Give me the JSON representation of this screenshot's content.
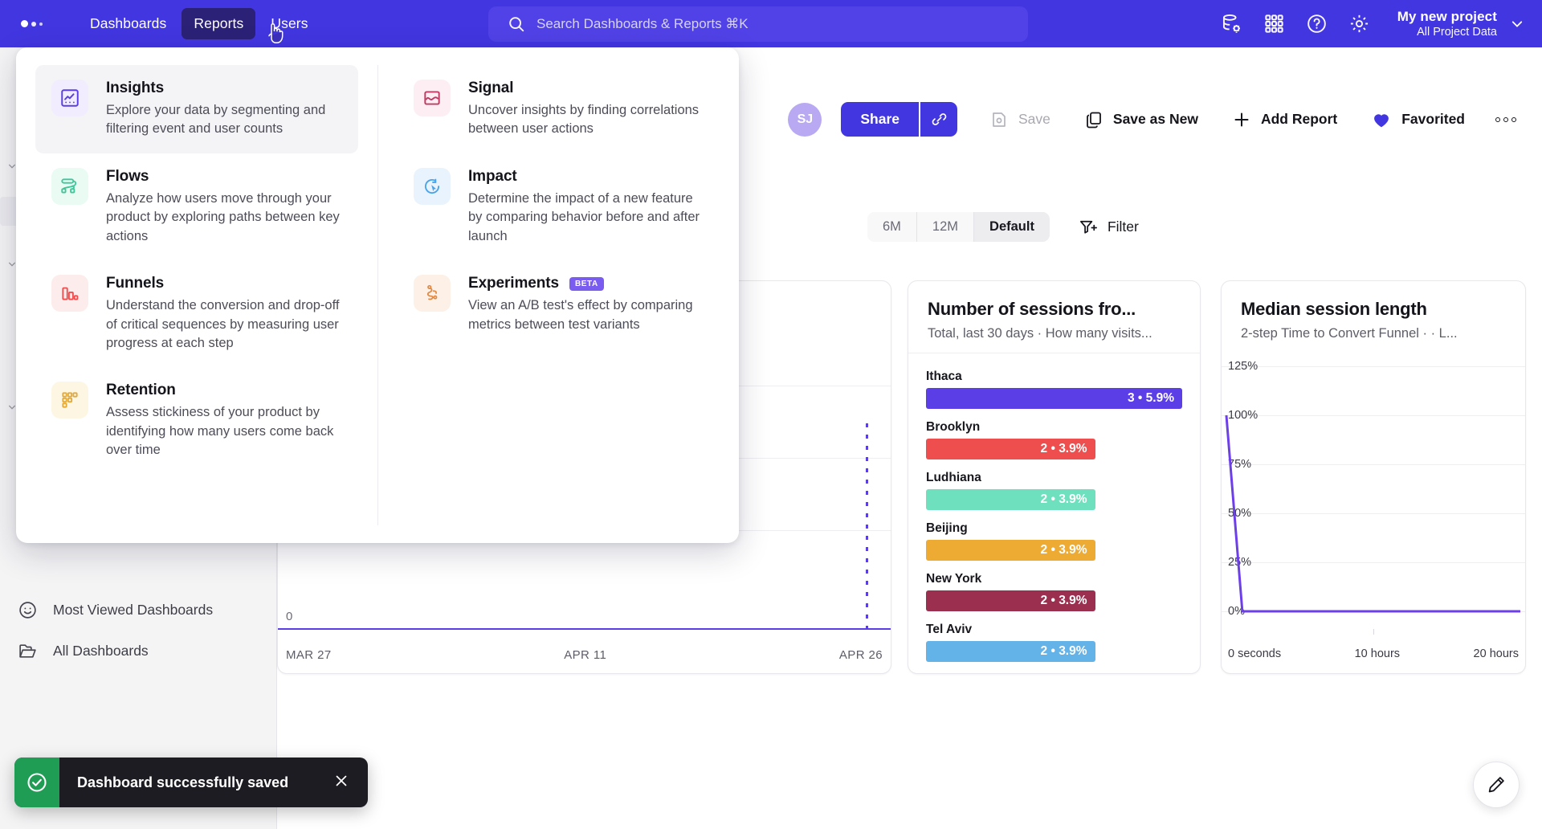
{
  "topnav": {
    "logo": "logo-dots",
    "links": [
      {
        "label": "Dashboards",
        "active": false
      },
      {
        "label": "Reports",
        "active": true
      },
      {
        "label": "Users",
        "active": false
      }
    ],
    "search_placeholder": "Search Dashboards & Reports ⌘K",
    "icons": [
      "database-settings-icon",
      "apps-grid-icon",
      "help-circle-icon",
      "gear-icon"
    ],
    "project": {
      "name": "My new project",
      "scope": "All Project Data"
    },
    "accent": "#4236e0"
  },
  "megamenu": {
    "left": [
      {
        "title": "Insights",
        "desc": "Explore your data by segmenting and filtering event and user counts",
        "icon": "insights-chart-icon",
        "icon_bg": "#f1ecfe",
        "icon_color": "#5b3ee6",
        "highlighted": true
      },
      {
        "title": "Flows",
        "desc": "Analyze how users move through your product by exploring paths between key actions",
        "icon": "flows-path-icon",
        "icon_bg": "#e9fbf3",
        "icon_color": "#3fc79a",
        "highlighted": false
      },
      {
        "title": "Funnels",
        "desc": "Understand the conversion and drop-off of critical sequences by measuring user progress at each step",
        "icon": "funnels-bars-icon",
        "icon_bg": "#fdecec",
        "icon_color": "#ef4e4e",
        "highlighted": false
      },
      {
        "title": "Retention",
        "desc": "Assess stickiness of your product by identifying how many users come back over time",
        "icon": "retention-grid-icon",
        "icon_bg": "#fdf6e3",
        "icon_color": "#e2a93b",
        "highlighted": false
      }
    ],
    "right": [
      {
        "title": "Signal",
        "desc": "Uncover insights by finding correlations between user actions",
        "icon": "signal-wave-icon",
        "icon_bg": "#fdeef3",
        "icon_color": "#c03a63",
        "badge": "",
        "highlighted": false
      },
      {
        "title": "Impact",
        "desc": "Determine the impact of a new feature by comparing behavior before and after launch",
        "icon": "impact-target-icon",
        "icon_bg": "#e8f3fd",
        "icon_color": "#4aa3e8",
        "badge": "",
        "highlighted": false
      },
      {
        "title": "Experiments",
        "desc": "View an A/B test's effect by comparing metrics between test variants",
        "icon": "experiments-flask-icon",
        "icon_bg": "#fdf0e6",
        "icon_color": "#e08a45",
        "badge": "BETA",
        "highlighted": false
      }
    ]
  },
  "toolbar": {
    "avatar_initials": "SJ",
    "share_label": "Share",
    "link_icon": "link-icon",
    "save_label": "Save",
    "save_disabled": true,
    "save_as_new_label": "Save as New",
    "add_report_label": "Add Report",
    "favorited_label": "Favorited",
    "more_label": "more-options"
  },
  "rangebar": {
    "options": [
      {
        "label": "6M",
        "selected": false
      },
      {
        "label": "12M",
        "selected": false
      },
      {
        "label": "Default",
        "selected": true
      }
    ],
    "filter_label": "Filter"
  },
  "sidebar": {
    "items": [
      {
        "label": "Most Viewed Dashboards",
        "icon": "smiley-icon"
      },
      {
        "label": "All Dashboards",
        "icon": "folder-icon"
      }
    ]
  },
  "toast": {
    "message": "Dashboard successfully saved",
    "icon": "check-circle-icon",
    "close_icon": "close-icon",
    "color": "#1f9d55"
  },
  "fab": {
    "icon": "edit-pencil-icon"
  },
  "chart_data": [
    {
      "id": "left-line",
      "type": "line",
      "title": "",
      "subtitle": "",
      "xlabel": "",
      "ylabel": "",
      "x_tick_labels": [
        "MAR 27",
        "APR 11",
        "APR 26"
      ],
      "y_tick_labels": [
        "0"
      ],
      "ylim": [
        0,
        1
      ],
      "series": [
        {
          "name": "events",
          "values": [
            0,
            0,
            0,
            0,
            0,
            0,
            0,
            0,
            0,
            0,
            0,
            0,
            0,
            0,
            0
          ]
        }
      ],
      "annotation": "dotted vertical marker at APR 26",
      "line_color": "#5b3ee6",
      "grid": true,
      "legend": "none"
    },
    {
      "id": "sessions-bars",
      "type": "bar",
      "title": "Number of sessions fro...",
      "subtitle": "Total, last 30 days · How many visits...",
      "orientation": "horizontal",
      "categories": [
        "Ithaca",
        "Brooklyn",
        "Ludhiana",
        "Beijing",
        "New York",
        "Tel Aviv"
      ],
      "values": [
        3,
        2,
        2,
        2,
        2,
        2
      ],
      "percents": [
        "5.9%",
        "3.9%",
        "3.9%",
        "3.9%",
        "3.9%",
        "3.9%"
      ],
      "value_labels": [
        "3 • 5.9%",
        "2 • 3.9%",
        "2 • 3.9%",
        "2 • 3.9%",
        "2 • 3.9%",
        "2 • 3.9%"
      ],
      "bar_widths_pct": [
        100,
        66,
        66,
        66,
        66,
        66
      ],
      "colors": [
        "#5b3ee6",
        "#ef4e4e",
        "#6fe0bd",
        "#eeab34",
        "#9b2f50",
        "#63b3e8"
      ],
      "xlabel": "",
      "ylabel": "",
      "grid": false,
      "legend": "none"
    },
    {
      "id": "median-session-length",
      "type": "line",
      "title": "Median session length",
      "subtitle": "2-step Time to Convert Funnel · · L...",
      "x_tick_labels": [
        "0 seconds",
        "10 hours",
        "20 hours"
      ],
      "y_tick_labels": [
        "125%",
        "100%",
        "75%",
        "50%",
        "25%",
        "0%"
      ],
      "ylim": [
        0,
        125
      ],
      "xlim": [
        0,
        24
      ],
      "x": [
        0,
        0.55,
        24
      ],
      "series": [
        {
          "name": "conversion",
          "values": [
            100,
            0,
            0
          ]
        }
      ],
      "line_color": "#6c3fe8",
      "grid": true,
      "legend": "none",
      "xlabel": "",
      "ylabel": ""
    }
  ]
}
